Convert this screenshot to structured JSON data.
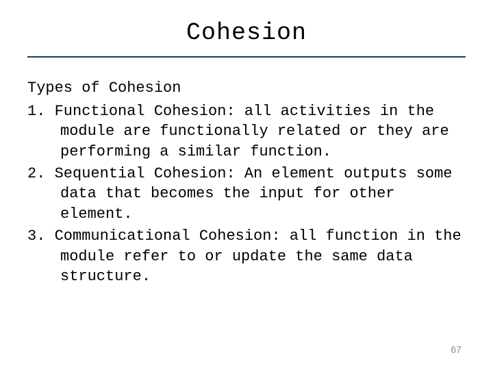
{
  "title": "Cohesion",
  "subhead": "Types of Cohesion",
  "items": [
    "Functional Cohesion: all activities in the module are functionally related or they are performing a similar function.",
    "Sequential Cohesion: An element outputs some data that becomes the input for other element.",
    "Communicational Cohesion: all function in the module refer to or update the same data structure."
  ],
  "page_number": "67"
}
